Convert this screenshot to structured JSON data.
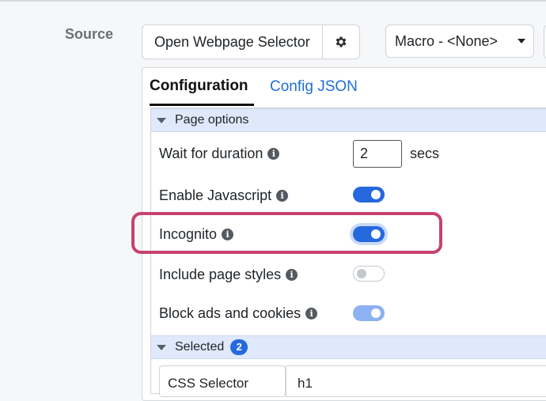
{
  "source": {
    "label": "Source",
    "open_selector_label": "Open Webpage Selector",
    "macro_value": "Macro - <None>"
  },
  "tabs": [
    {
      "label": "Configuration",
      "active": true
    },
    {
      "label": "Config JSON",
      "active": false
    }
  ],
  "page_options": {
    "header": "Page options",
    "wait": {
      "label": "Wait for duration",
      "value": "2",
      "unit": "secs"
    },
    "toggles": [
      {
        "label": "Enable Javascript",
        "on": true
      },
      {
        "label": "Incognito",
        "on": true,
        "highlighted": true
      },
      {
        "label": "Include page styles",
        "on": false
      },
      {
        "label": "Block ads and cookies",
        "on": true,
        "disabled": true
      }
    ]
  },
  "selected": {
    "header": "Selected",
    "count": "2",
    "selector_type": "CSS Selector",
    "selector_value": "h1"
  },
  "colors": {
    "accent": "#2668de",
    "highlight": "#c7426e",
    "section_bg": "#dfe9fb"
  },
  "icons": [
    "gear-icon",
    "caret-down-icon",
    "info-icon",
    "collapse-triangle-icon"
  ]
}
